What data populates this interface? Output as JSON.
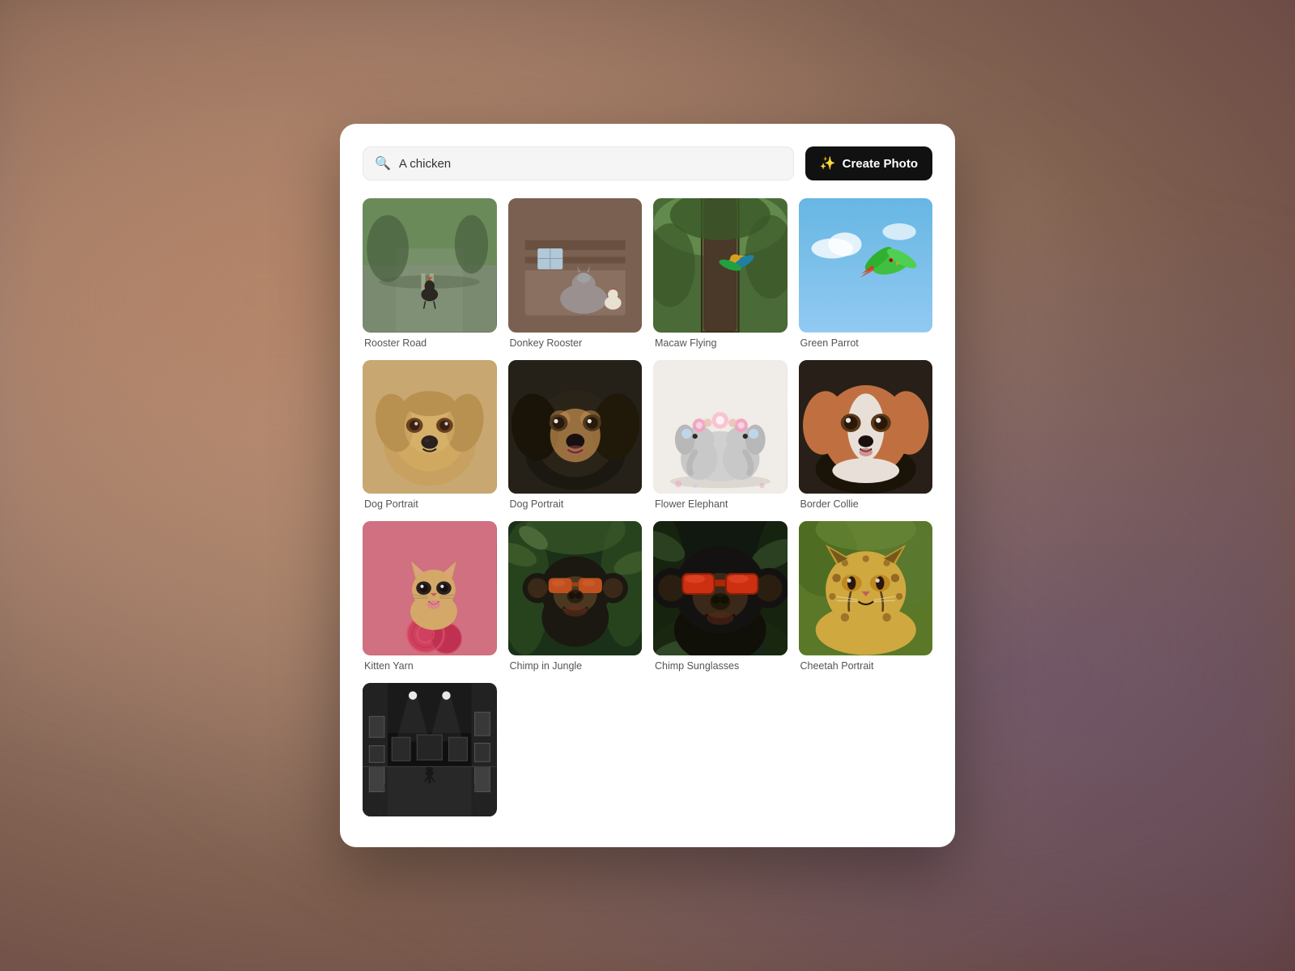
{
  "background": {
    "description": "blurred colorful background"
  },
  "panel": {
    "search": {
      "placeholder": "A chicken",
      "value": "A chicken",
      "icon": "🔍"
    },
    "create_button": {
      "label": "Create Photo",
      "icon": "✨"
    },
    "grid": {
      "items": [
        {
          "id": "rooster-road",
          "label": "Rooster Road",
          "bg_class": "img-rooster-road",
          "col": 1,
          "row": 1
        },
        {
          "id": "donkey-rooster",
          "label": "Donkey Rooster",
          "bg_class": "img-donkey-rooster",
          "col": 2,
          "row": 1
        },
        {
          "id": "macaw-flying",
          "label": "Macaw Flying",
          "bg_class": "img-macaw-flying",
          "col": 3,
          "row": 1
        },
        {
          "id": "green-parrot",
          "label": "Green Parrot",
          "bg_class": "img-green-parrot",
          "col": 4,
          "row": 1
        },
        {
          "id": "dog-portrait-1",
          "label": "Dog Portrait",
          "bg_class": "img-dog-portrait1",
          "col": 1,
          "row": 2
        },
        {
          "id": "dog-portrait-2",
          "label": "Dog Portrait",
          "bg_class": "img-dog-portrait2",
          "col": 2,
          "row": 2
        },
        {
          "id": "flower-elephant",
          "label": "Flower Elephant",
          "bg_class": "img-flower-elephant",
          "col": 3,
          "row": 2
        },
        {
          "id": "border-collie",
          "label": "Border Collie",
          "bg_class": "img-border-collie",
          "col": 4,
          "row": 2
        },
        {
          "id": "kitten-yarn",
          "label": "Kitten Yarn",
          "bg_class": "img-kitten-yarn",
          "col": 1,
          "row": 3
        },
        {
          "id": "chimp-jungle",
          "label": "Chimp in Jungle",
          "bg_class": "img-chimp-jungle",
          "col": 2,
          "row": 3
        },
        {
          "id": "chimp-sunglasses",
          "label": "Chimp Sunglasses",
          "bg_class": "img-chimp-sunglasses",
          "col": 3,
          "row": 3
        },
        {
          "id": "cheetah-portrait",
          "label": "Cheetah Portrait",
          "bg_class": "img-cheetah-portrait",
          "col": 4,
          "row": 3
        },
        {
          "id": "gallery",
          "label": "",
          "bg_class": "img-gallery",
          "col": 1,
          "row": 4
        }
      ]
    }
  }
}
